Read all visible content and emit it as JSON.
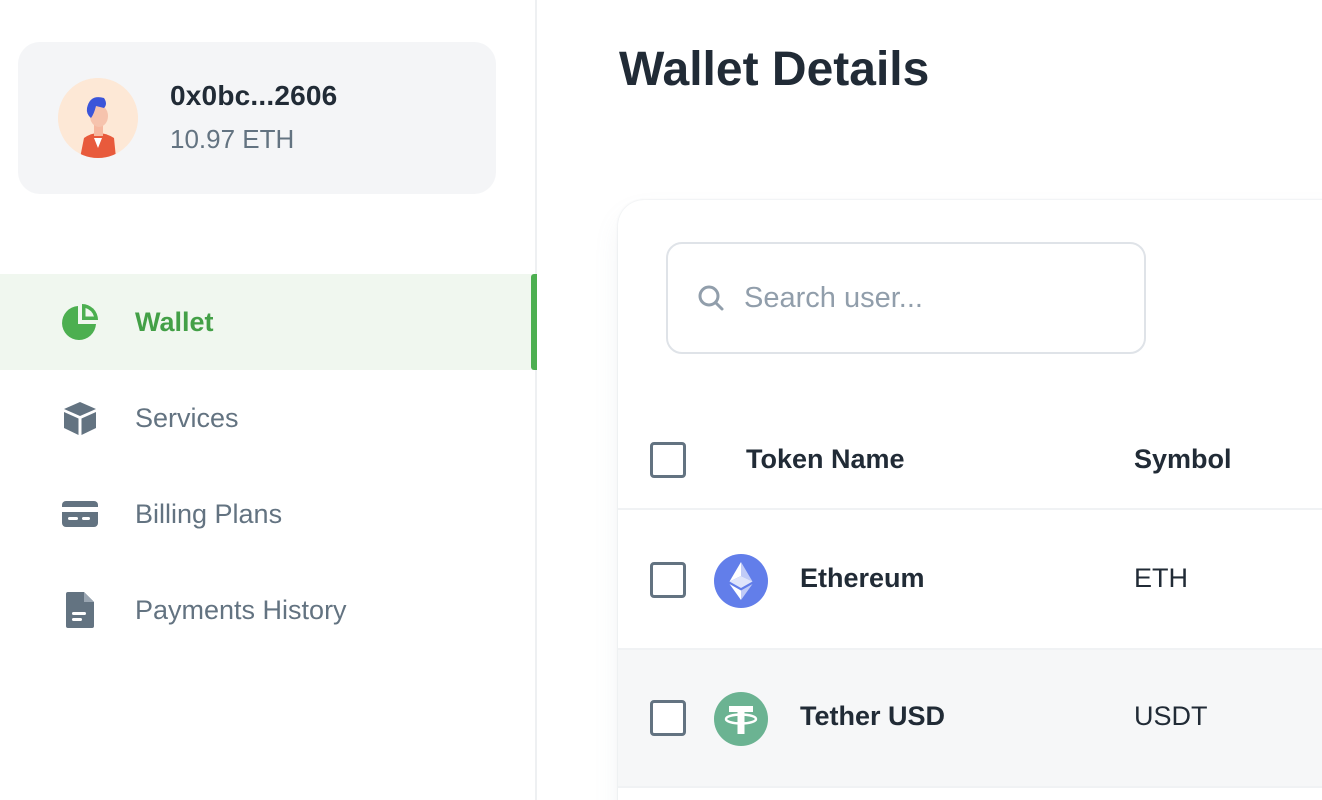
{
  "account": {
    "address": "0x0bc...2606",
    "balance": "10.97 ETH"
  },
  "nav": {
    "items": [
      {
        "label": "Wallet",
        "icon": "pie-chart-icon",
        "active": true
      },
      {
        "label": "Services",
        "icon": "cube-icon",
        "active": false
      },
      {
        "label": "Billing Plans",
        "icon": "credit-card-icon",
        "active": false
      },
      {
        "label": "Payments History",
        "icon": "file-icon",
        "active": false
      }
    ]
  },
  "page": {
    "title": "Wallet Details"
  },
  "search": {
    "placeholder": "Search user...",
    "icon": "search-icon"
  },
  "table": {
    "headers": [
      "Token Name",
      "Symbol"
    ],
    "rows": [
      {
        "name": "Ethereum",
        "symbol": "ETH",
        "icon": "ethereum-icon"
      },
      {
        "name": "Tether USD",
        "symbol": "USDT",
        "icon": "tether-icon"
      }
    ]
  },
  "colors": {
    "accent": "#43a047",
    "active_bg": "#f0f7ef",
    "muted_text": "#637381",
    "ethereum": "#627eea",
    "tether": "#6bb392"
  }
}
